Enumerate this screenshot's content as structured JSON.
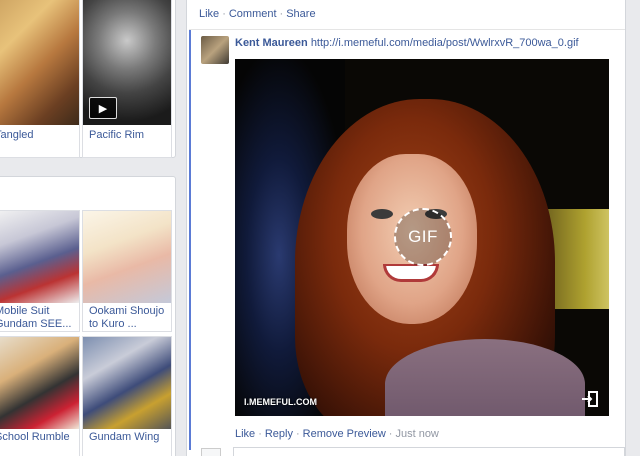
{
  "sidebar": {
    "movies": [
      {
        "title": "Tangled"
      },
      {
        "title": "Pacific Rim",
        "has_play": true
      }
    ],
    "books": [
      {
        "title_line1": "Mobile Suit",
        "title_line2": "Gundam SEE..."
      },
      {
        "title_line1": "Ookami Shoujo",
        "title_line2": "to Kuro ..."
      },
      {
        "title": "School Rumble"
      },
      {
        "title": "Gundam Wing"
      }
    ]
  },
  "post_actions": {
    "like": "Like",
    "comment": "Comment",
    "share": "Share",
    "separator": "·"
  },
  "comment": {
    "author": "Kent Maureen",
    "url": "http://i.memeful.com/media/post/WwlrxvR_700wa_0.gif",
    "preview": {
      "badge": "GIF",
      "watermark": "I.MEMEFUL.COM"
    },
    "actions": {
      "like": "Like",
      "reply": "Reply",
      "remove_preview": "Remove Preview",
      "timestamp": "Just now"
    }
  },
  "icons": {
    "play": "play-icon",
    "gif_share": "external-link-icon"
  },
  "colors": {
    "link": "#3b5998",
    "accent_border": "#5b7bd5",
    "meta": "#9197a3",
    "background": "#e9eaed"
  }
}
